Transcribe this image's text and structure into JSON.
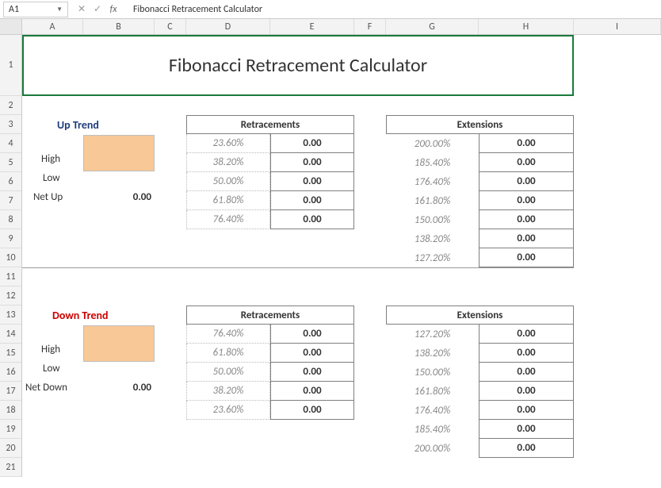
{
  "name_box": "A1",
  "formula_text": "Fibonacci Retracement Calculator",
  "columns": [
    "A",
    "B",
    "C",
    "D",
    "E",
    "F",
    "G",
    "H",
    "I"
  ],
  "rows": [
    "1",
    "2",
    "3",
    "4",
    "5",
    "6",
    "7",
    "8",
    "9",
    "10",
    "11",
    "12",
    "13",
    "14",
    "15",
    "16",
    "17",
    "18",
    "19",
    "20",
    "21"
  ],
  "title": "Fibonacci Retracement Calculator",
  "up": {
    "title": "Up Trend",
    "high": "High",
    "low": "Low",
    "net": "Net Up",
    "net_val": "0.00",
    "retr_header": "Retracements",
    "ext_header": "Extensions",
    "retracements": [
      {
        "pct": "23.60%",
        "val": "0.00"
      },
      {
        "pct": "38.20%",
        "val": "0.00"
      },
      {
        "pct": "50.00%",
        "val": "0.00"
      },
      {
        "pct": "61.80%",
        "val": "0.00"
      },
      {
        "pct": "76.40%",
        "val": "0.00"
      }
    ],
    "extensions": [
      {
        "pct": "200.00%",
        "val": "0.00"
      },
      {
        "pct": "185.40%",
        "val": "0.00"
      },
      {
        "pct": "176.40%",
        "val": "0.00"
      },
      {
        "pct": "161.80%",
        "val": "0.00"
      },
      {
        "pct": "150.00%",
        "val": "0.00"
      },
      {
        "pct": "138.20%",
        "val": "0.00"
      },
      {
        "pct": "127.20%",
        "val": "0.00"
      }
    ]
  },
  "down": {
    "title": "Down Trend",
    "high": "High",
    "low": "Low",
    "net": "Net Down",
    "net_val": "0.00",
    "retr_header": "Retracements",
    "ext_header": "Extensions",
    "retracements": [
      {
        "pct": "76.40%",
        "val": "0.00"
      },
      {
        "pct": "61.80%",
        "val": "0.00"
      },
      {
        "pct": "50.00%",
        "val": "0.00"
      },
      {
        "pct": "38.20%",
        "val": "0.00"
      },
      {
        "pct": "23.60%",
        "val": "0.00"
      }
    ],
    "extensions": [
      {
        "pct": "127.20%",
        "val": "0.00"
      },
      {
        "pct": "138.20%",
        "val": "0.00"
      },
      {
        "pct": "150.00%",
        "val": "0.00"
      },
      {
        "pct": "161.80%",
        "val": "0.00"
      },
      {
        "pct": "176.40%",
        "val": "0.00"
      },
      {
        "pct": "185.40%",
        "val": "0.00"
      },
      {
        "pct": "200.00%",
        "val": "0.00"
      }
    ]
  }
}
